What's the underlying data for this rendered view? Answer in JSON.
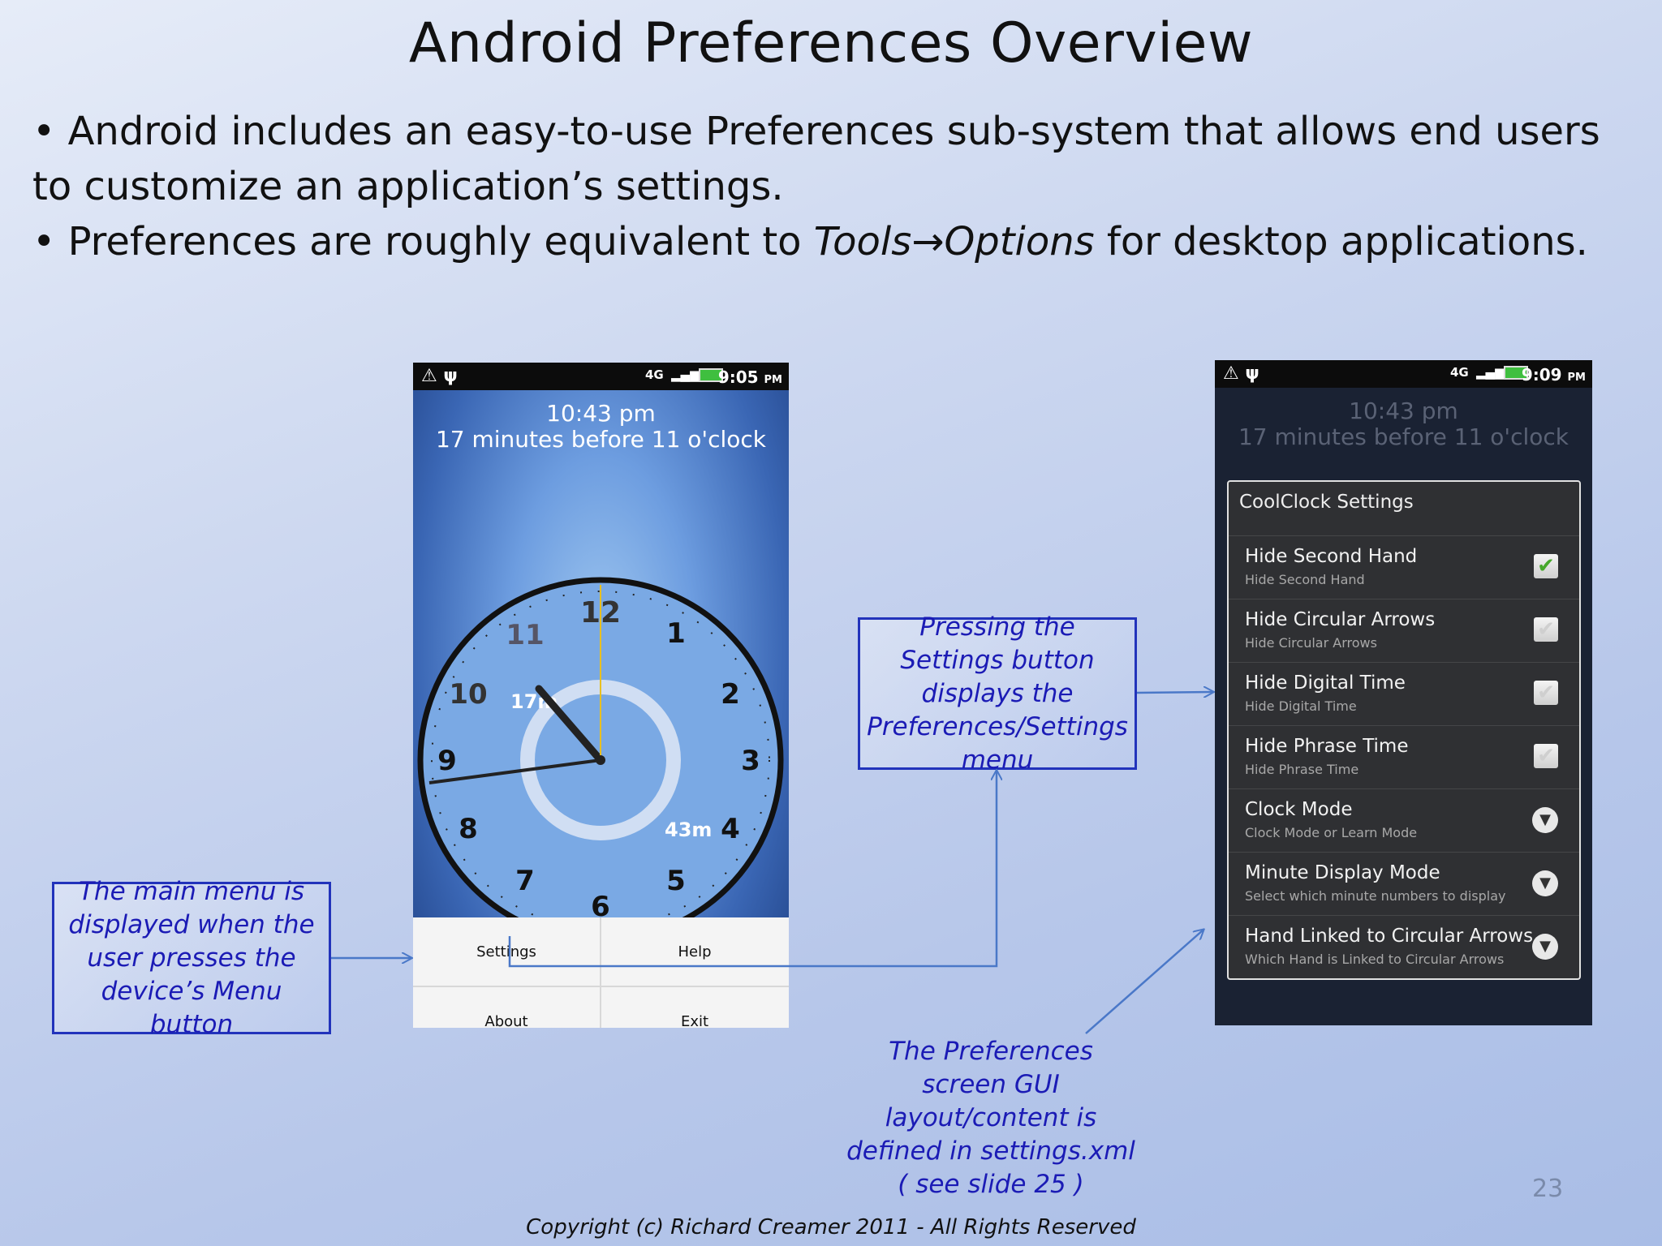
{
  "slide": {
    "title": "Android Preferences Overview",
    "bullets": [
      "• Android includes an easy-to-use Preferences sub-system that allows end users to customize an application’s settings.",
      {
        "pre": "• Preferences are roughly equivalent to ",
        "em1": "Tools",
        "arrow": "→",
        "em2": "Options",
        "post": " for desktop applications."
      }
    ],
    "page_number": "23",
    "copyright": "Copyright (c) Richard Creamer 2011 - All Rights Reserved"
  },
  "phone1": {
    "status": {
      "left_icons": "⚠ ψ",
      "net": "4G",
      "time": "9:05",
      "ampm": "PM"
    },
    "clock_time": "10:43 pm",
    "clock_phrase": "17 minutes before 11 o'clock",
    "dial": {
      "minutes_before": "17m",
      "minutes_after": "43m",
      "hours": [
        "12",
        "1",
        "2",
        "3",
        "4",
        "5",
        "6",
        "7",
        "8",
        "9",
        "10",
        "11"
      ]
    },
    "menu": {
      "settings": "Settings",
      "help": "Help",
      "about": "About",
      "exit": "Exit"
    }
  },
  "phone2": {
    "status": {
      "left_icons": "⚠ ψ",
      "net": "4G",
      "time": "9:09",
      "ampm": "PM"
    },
    "clock_time": "10:43 pm",
    "clock_phrase": "17 minutes before 11 o'clock",
    "dialog_title": "CoolClock Settings",
    "prefs": [
      {
        "title": "Hide Second Hand",
        "summary": "Hide Second Hand",
        "widget": "checkbox",
        "checked": true
      },
      {
        "title": "Hide Circular Arrows",
        "summary": "Hide Circular Arrows",
        "widget": "checkbox",
        "checked": false
      },
      {
        "title": "Hide Digital Time",
        "summary": "Hide Digital Time",
        "widget": "checkbox",
        "checked": false
      },
      {
        "title": "Hide Phrase Time",
        "summary": "Hide Phrase Time",
        "widget": "checkbox",
        "checked": false
      },
      {
        "title": "Clock Mode",
        "summary": "Clock Mode or Learn Mode",
        "widget": "dropdown"
      },
      {
        "title": "Minute Display Mode",
        "summary": "Select which minute numbers to display",
        "widget": "dropdown"
      },
      {
        "title": "Hand Linked to Circular Arrows",
        "summary": "Which Hand is Linked to Circular Arrows",
        "widget": "dropdown"
      }
    ]
  },
  "callouts": {
    "main_menu": "The main menu is displayed when the user presses the device’s Menu button",
    "settings": "Pressing the Settings button displays the Preferences/Settings menu",
    "prefs_screen": "The Preferences screen GUI layout/content is defined in settings.xml ( see slide 25 )"
  },
  "colors": {
    "callout_text": "#1b1bb5",
    "callout_border": "#2233bb",
    "arrow": "#4a78c8",
    "check_on": "#46a82b"
  }
}
